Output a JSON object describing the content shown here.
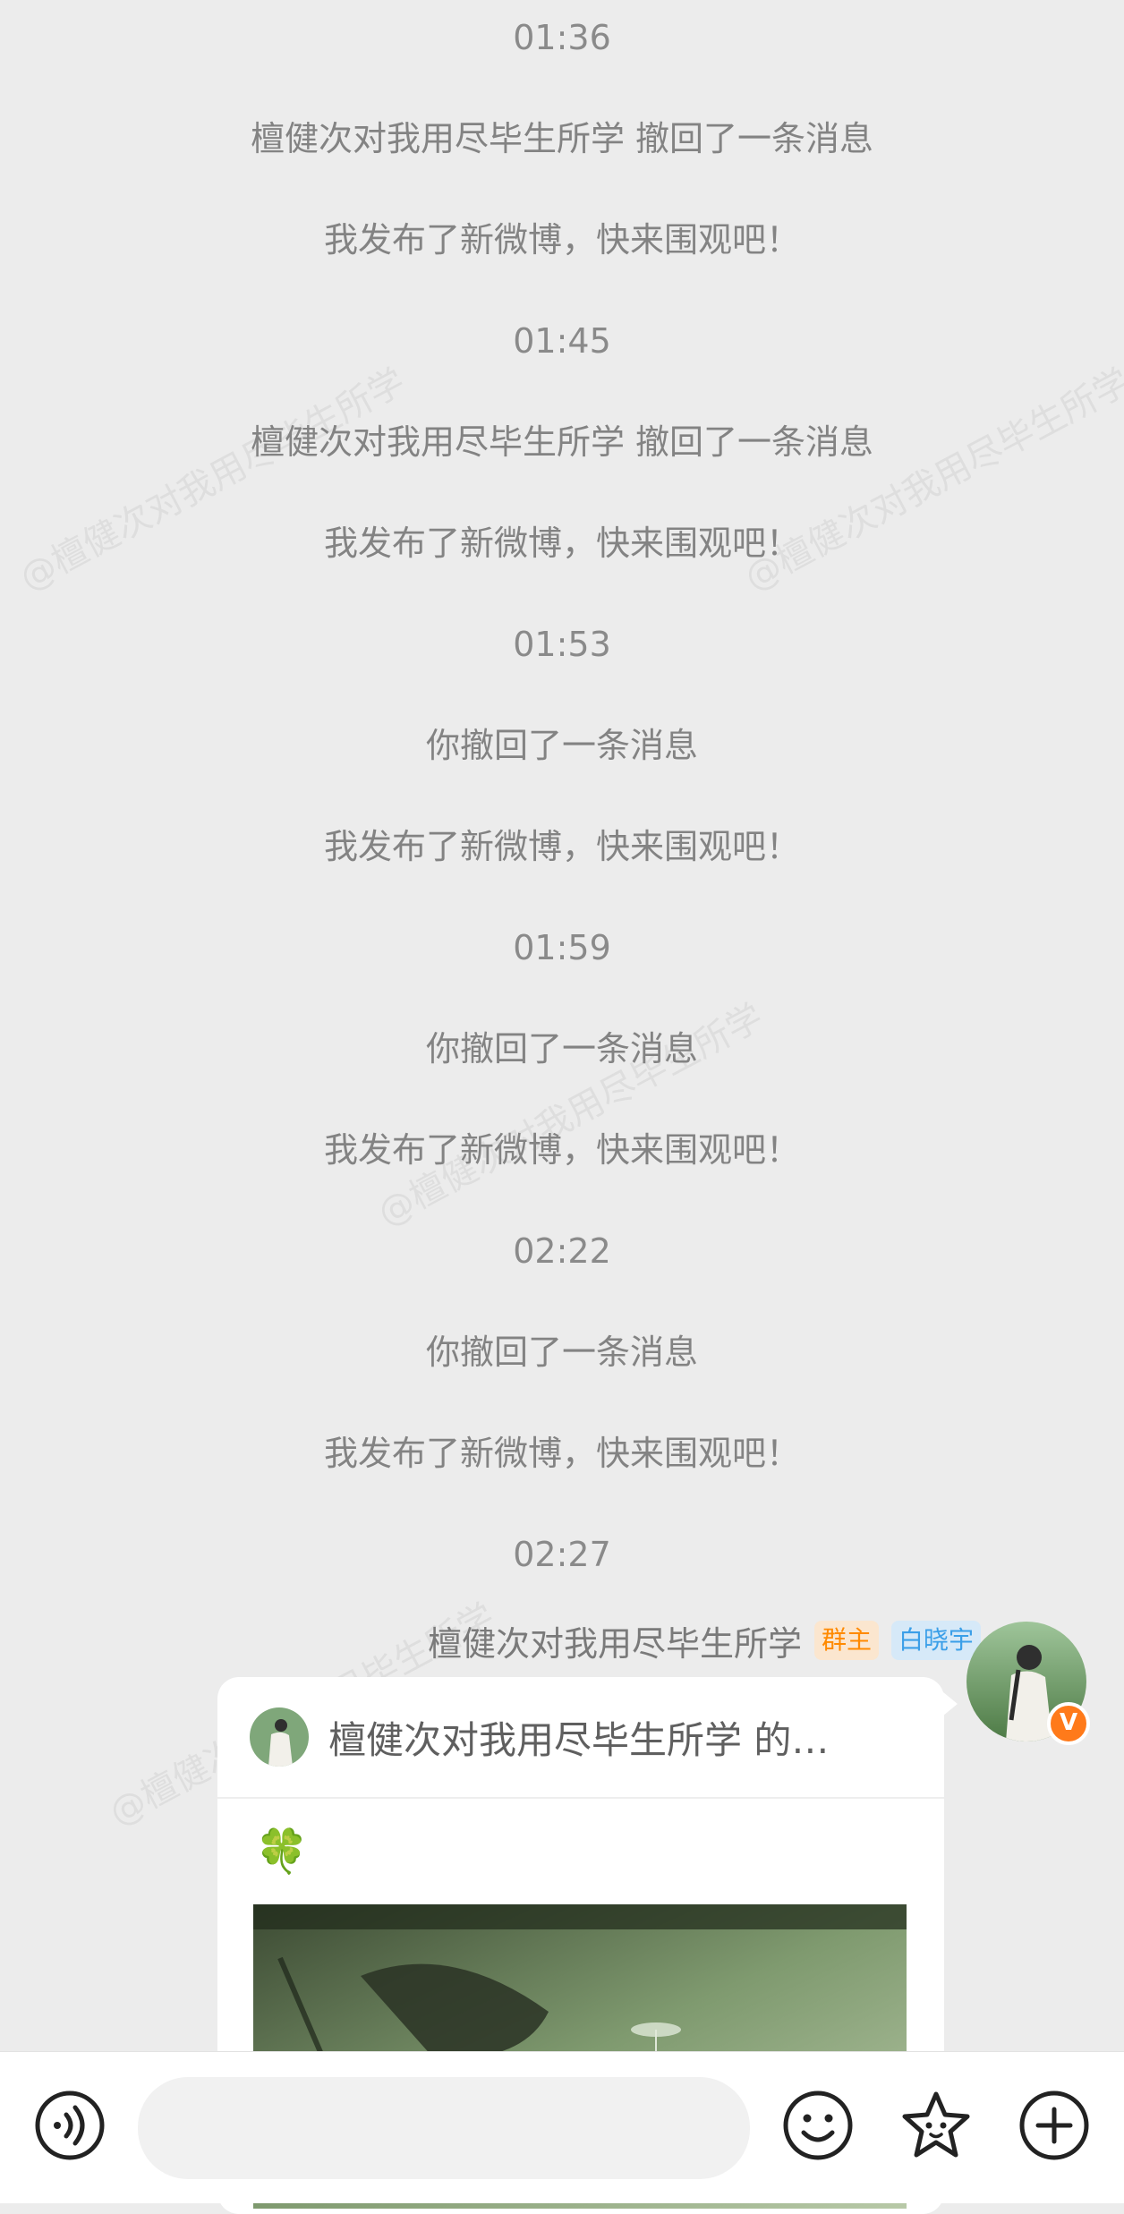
{
  "watermark": "@檀健次对我用尽毕生所学",
  "messages": [
    {
      "type": "time",
      "text": "01:36"
    },
    {
      "type": "system",
      "text": "檀健次对我用尽毕生所学 撤回了一条消息"
    },
    {
      "type": "system",
      "text": "我发布了新微博，快来围观吧！"
    },
    {
      "type": "time",
      "text": "01:45"
    },
    {
      "type": "system",
      "text": "檀健次对我用尽毕生所学 撤回了一条消息"
    },
    {
      "type": "system",
      "text": "我发布了新微博，快来围观吧！"
    },
    {
      "type": "time",
      "text": "01:53"
    },
    {
      "type": "system",
      "text": "你撤回了一条消息"
    },
    {
      "type": "system",
      "text": "我发布了新微博，快来围观吧！"
    },
    {
      "type": "time",
      "text": "01:59"
    },
    {
      "type": "system",
      "text": "你撤回了一条消息"
    },
    {
      "type": "system",
      "text": "我发布了新微博，快来围观吧！"
    },
    {
      "type": "time",
      "text": "02:22"
    },
    {
      "type": "system",
      "text": "你撤回了一条消息"
    },
    {
      "type": "system",
      "text": "我发布了新微博，快来围观吧！"
    },
    {
      "type": "time",
      "text": "02:27"
    }
  ],
  "sender": {
    "name": "檀健次对我用尽毕生所学",
    "badge_owner": "群主",
    "badge_tag": "白晓宇",
    "vip_mark": "V"
  },
  "card": {
    "title": "檀健次对我用尽毕生所学 的…",
    "emoji": "🍀"
  },
  "bottom_bar": {
    "voice_icon": "voice-icon",
    "emoji_icon": "smiley-icon",
    "sticker_icon": "star-sticker-icon",
    "plus_icon": "plus-icon"
  },
  "colors": {
    "owner_badge": "#ff8a00",
    "tag_badge": "#3b9fe8",
    "vip": "#ff7a1a"
  }
}
